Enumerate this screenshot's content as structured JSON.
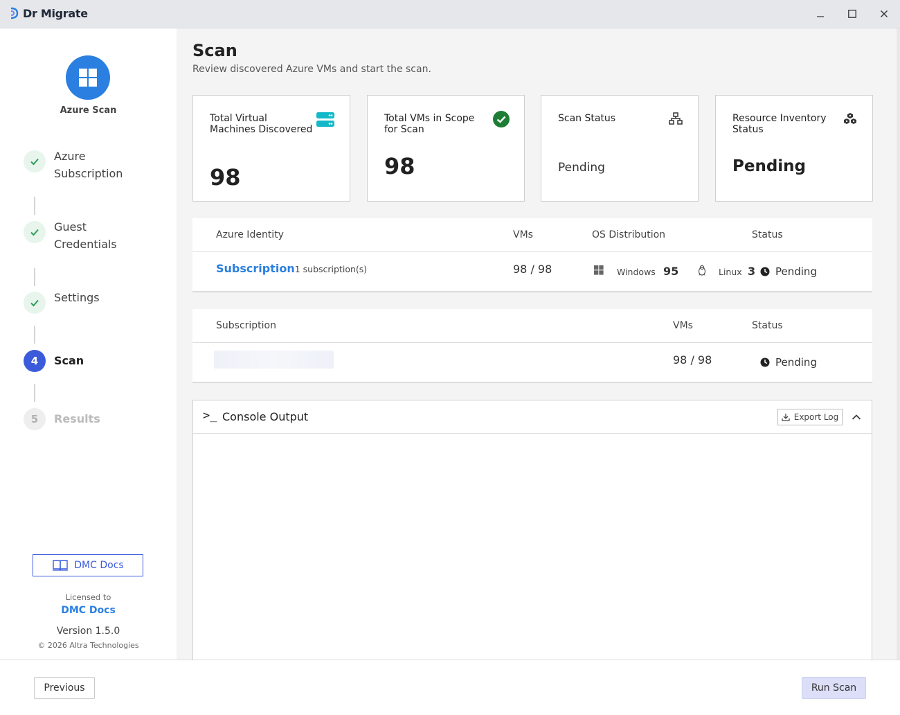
{
  "window": {
    "title": "Dr Migrate",
    "controls": {
      "minimize": "—",
      "maximize": "☐",
      "close": "✕"
    }
  },
  "sidebar": {
    "brand_label": "Azure Scan",
    "steps": [
      {
        "label_line1": "Azure",
        "label_line2": "Subscription",
        "state": "done"
      },
      {
        "label_line1": "Guest",
        "label_line2": "Credentials",
        "state": "done"
      },
      {
        "label_line1": "Settings",
        "state": "done"
      },
      {
        "number": "4",
        "label_line1": "Scan",
        "state": "active"
      },
      {
        "number": "5",
        "label_line1": "Results",
        "state": "pending"
      }
    ],
    "docs_button": "DMC Docs",
    "licensed_to_label": "Licensed to",
    "licensed_to_name": "DMC Docs",
    "version": "Version 1.5.0",
    "copyright": "© 2026 Altra Technologies"
  },
  "main": {
    "title": "Scan",
    "subtitle": "Review discovered Azure VMs and start the scan.",
    "cards": [
      {
        "label": "Total Virtual Machines Discovered",
        "value": "98",
        "icon": "server-icon"
      },
      {
        "label": "Total VMs in Scope for Scan",
        "value": "98",
        "icon": "check-circle-icon"
      },
      {
        "label": "Scan Status",
        "value": "Pending",
        "icon": "network-icon"
      },
      {
        "label": "Resource Inventory Status",
        "value": "Pending",
        "icon": "cubes-icon"
      }
    ],
    "identity_table": {
      "headers": [
        "Azure Identity",
        "VMs",
        "OS Distribution",
        "Status"
      ],
      "row": {
        "name": "Subscription",
        "count_text": "1 subscription(s)",
        "vms": "98 / 98",
        "windows_label": "Windows",
        "windows_count": "95",
        "linux_label": "Linux",
        "linux_count": "3",
        "status": "Pending"
      }
    },
    "subscription_table": {
      "headers": [
        "Subscription",
        "VMs",
        "Status"
      ],
      "row": {
        "vms": "98 / 98",
        "status": "Pending"
      }
    },
    "console": {
      "prompt": ">_",
      "title": "Console Output",
      "export_label": "Export Log"
    }
  },
  "footer": {
    "previous_label": "Previous",
    "run_label": "Run Scan"
  },
  "colors": {
    "accent_blue": "#2a7fe0",
    "active_step": "#3b5bdb",
    "success_green": "#1e7d34",
    "teal_icon": "#14b8c8"
  }
}
